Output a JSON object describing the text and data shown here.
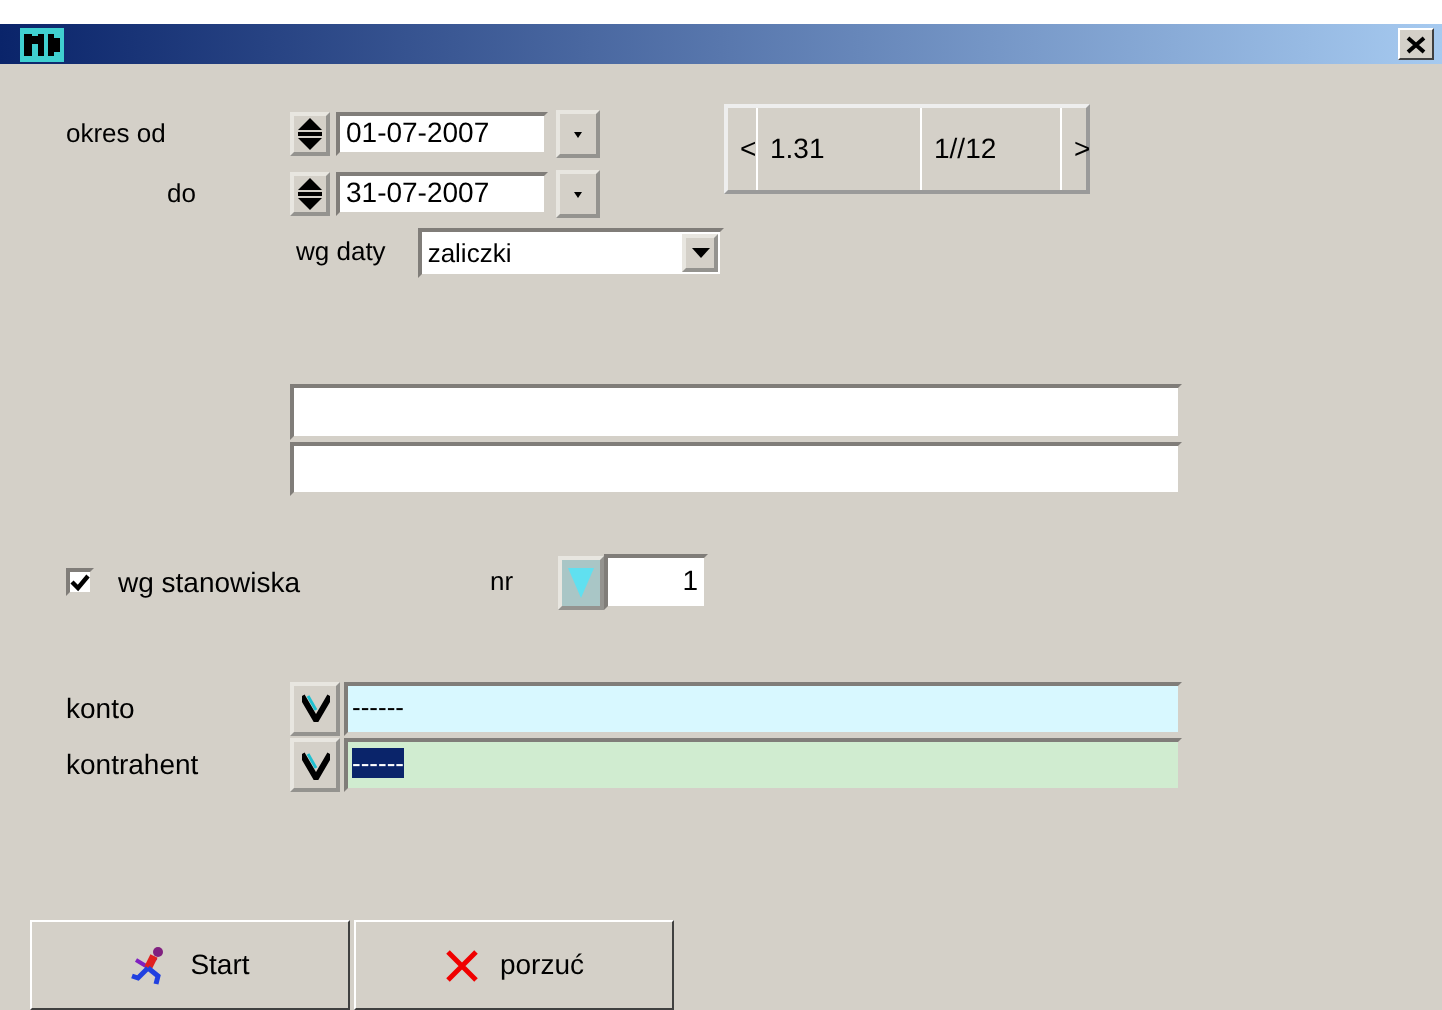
{
  "date_range": {
    "from_label": "okres od",
    "from": "01-07-2007",
    "to_label": "do",
    "to": "31-07-2007"
  },
  "date_basis": {
    "label": "wg daty",
    "value": "zaliczki"
  },
  "navigator": {
    "prev": "<",
    "period": "1.31",
    "page": "1//12",
    "next": ">"
  },
  "station": {
    "label": "wg stanowiska",
    "checked": true,
    "nr_label": "nr",
    "nr": "1"
  },
  "lookups": [
    {
      "label": "konto",
      "value": "------",
      "color": "#d8f8ff",
      "selected": false
    },
    {
      "label": "kontrahent",
      "value": "------",
      "color": "#d0ecd0",
      "selected": true
    }
  ],
  "buttons": [
    {
      "kind": "start",
      "label": "Start"
    },
    {
      "kind": "cancel",
      "label": "porzuć"
    }
  ]
}
